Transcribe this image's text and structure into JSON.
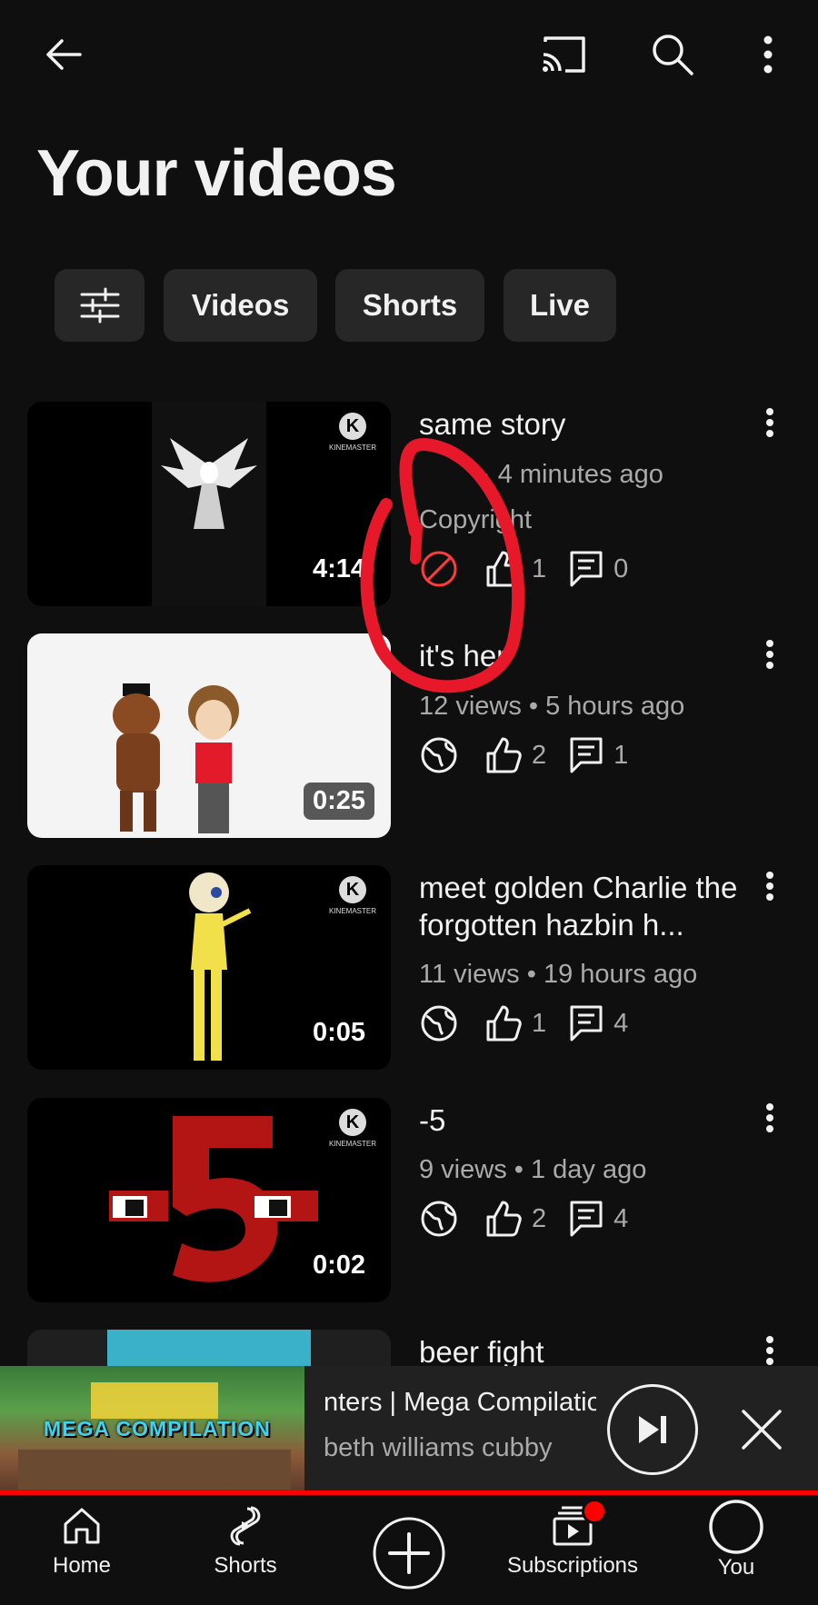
{
  "header": {
    "back_icon": "arrow-left-icon",
    "cast_icon": "cast-icon",
    "search_icon": "search-icon",
    "more_icon": "more-vertical-icon"
  },
  "page_title": "Your videos",
  "chips": [
    {
      "icon": "filter-sliders-icon"
    },
    {
      "label": "Videos"
    },
    {
      "label": "Shorts"
    },
    {
      "label": "Live"
    }
  ],
  "videos": [
    {
      "title": "same story",
      "meta": "· 4 minutes ago",
      "status": "Copyright",
      "visibility_icon": "blocked-icon",
      "likes": "1",
      "comments": "0",
      "duration": "4:14"
    },
    {
      "title": "it's her",
      "meta": "12 views • 5 hours ago",
      "visibility_icon": "globe-icon",
      "likes": "2",
      "comments": "1",
      "duration": "0:25"
    },
    {
      "title": "meet golden Charlie the forgotten hazbin h...",
      "meta": "11 views • 19 hours ago",
      "visibility_icon": "globe-icon",
      "likes": "1",
      "comments": "4",
      "duration": "0:05"
    },
    {
      "title": "-5",
      "meta": "9 views • 1 day ago",
      "visibility_icon": "globe-icon",
      "likes": "2",
      "comments": "4",
      "duration": "0:02"
    },
    {
      "title": "beer fight"
    }
  ],
  "watermark": {
    "letter": "K",
    "text": "KINEMASTER"
  },
  "mini_player": {
    "thumb_text": "MEGA COMPILATION",
    "title": "nters | Mega Compilatio",
    "channel": "beth williams cubby"
  },
  "bottom_nav": [
    {
      "label": "Home",
      "icon": "home-icon"
    },
    {
      "label": "Shorts",
      "icon": "shorts-icon"
    },
    {
      "icon": "create-plus-icon"
    },
    {
      "label": "Subscriptions",
      "icon": "subscriptions-icon"
    },
    {
      "label": "You",
      "icon": "you-avatar-icon"
    }
  ],
  "colors": {
    "background": "#0f0f0f",
    "chip": "#272727",
    "accent_red": "#ff0000",
    "annotation": "#e8182b",
    "secondary_text": "#aaaaaa"
  }
}
